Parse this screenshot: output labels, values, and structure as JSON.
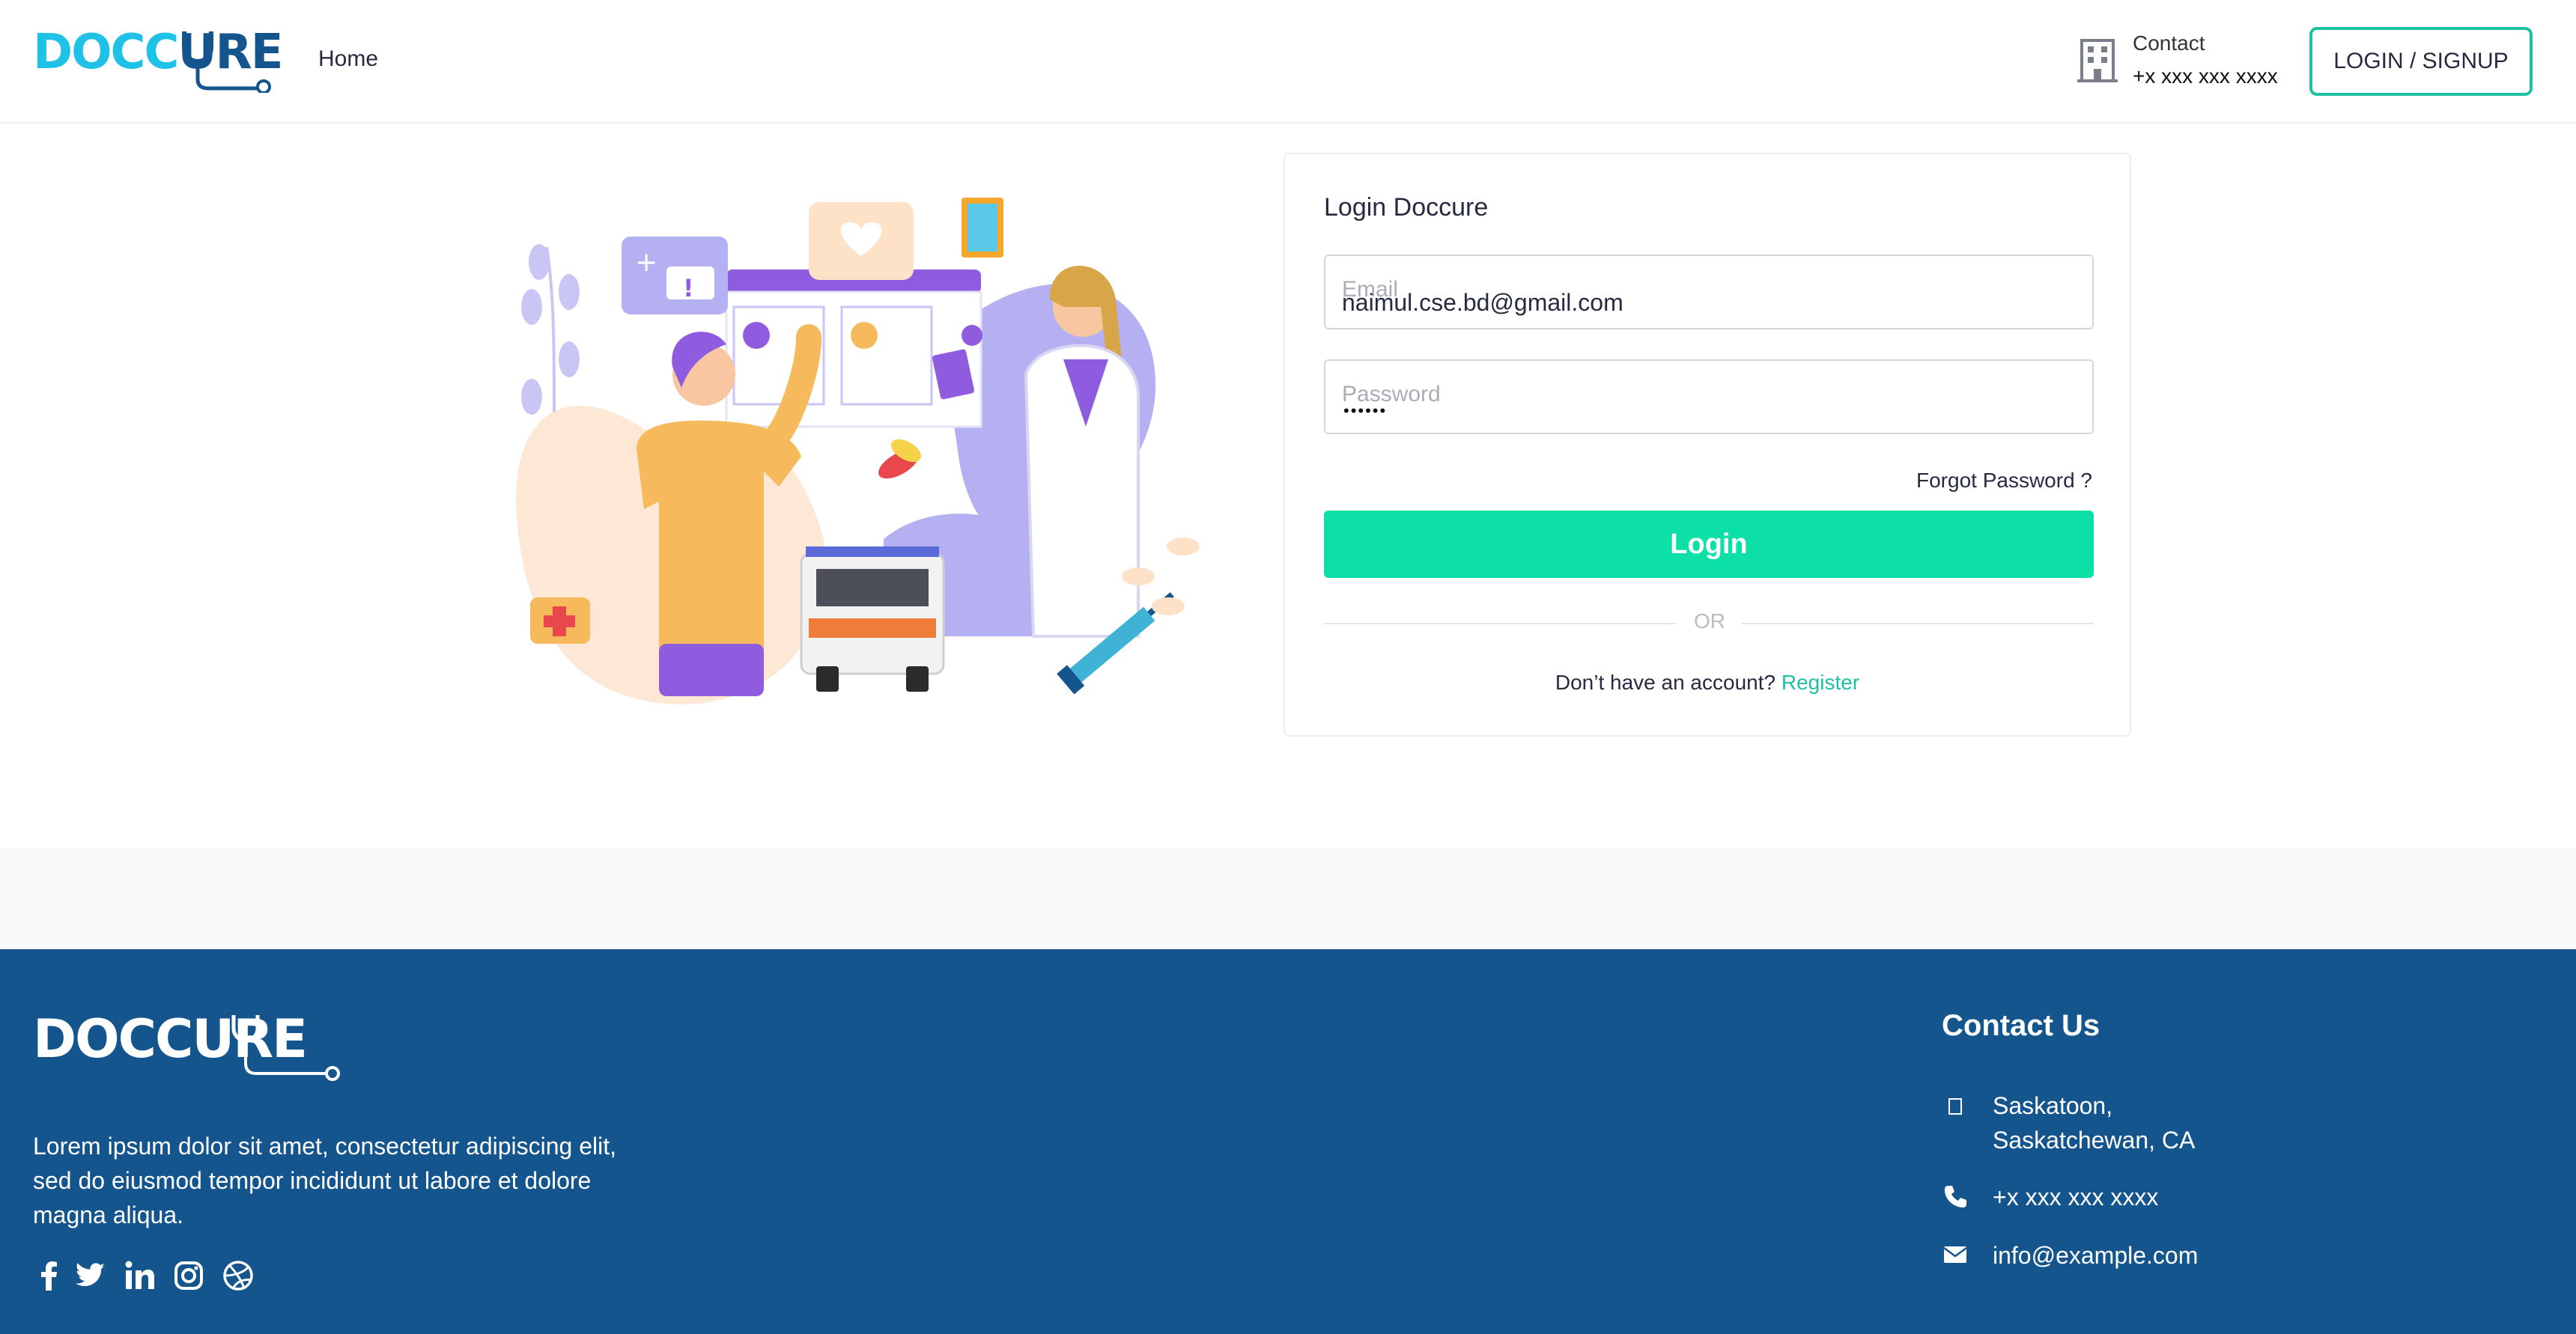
{
  "header": {
    "logo_part1": "DOCC",
    "logo_part2": "URE",
    "nav_home": "Home",
    "contact_label": "Contact",
    "contact_phone": "+x xxx xxx xxxx",
    "login_signup": "LOGIN / SIGNUP"
  },
  "login": {
    "title": "Login Doccure",
    "email_placeholder": "Email",
    "email_value": "naimul.cse.bd@gmail.com",
    "password_placeholder": "Password",
    "password_dots": "••••••",
    "forgot_password": "Forgot Password ?",
    "login_button": "Login",
    "or": "OR",
    "no_account": "Don’t have an account?",
    "register": "Register"
  },
  "footer": {
    "logo": "DOCCURE",
    "about": "Lorem ipsum dolor sit amet, consectetur adipiscing elit, sed do eiusmod tempor incididunt ut labore et dolore magna aliqua.",
    "contact_title": "Contact Us",
    "address_line1": "Saskatoon,",
    "address_line2": "Saskatchewan, CA",
    "phone": "+x xxx xxx xxxx",
    "email": "info@example.com"
  },
  "colors": {
    "primary_blue": "#15558d",
    "logo_cyan": "#1fc2e6",
    "accent_green": "#0de0a6",
    "link_green": "#20c0a3"
  },
  "icons": [
    "building-icon",
    "facebook-icon",
    "twitter-icon",
    "linkedin-icon",
    "instagram-icon",
    "dribbble-icon",
    "map-marker-icon",
    "phone-icon",
    "envelope-icon"
  ]
}
